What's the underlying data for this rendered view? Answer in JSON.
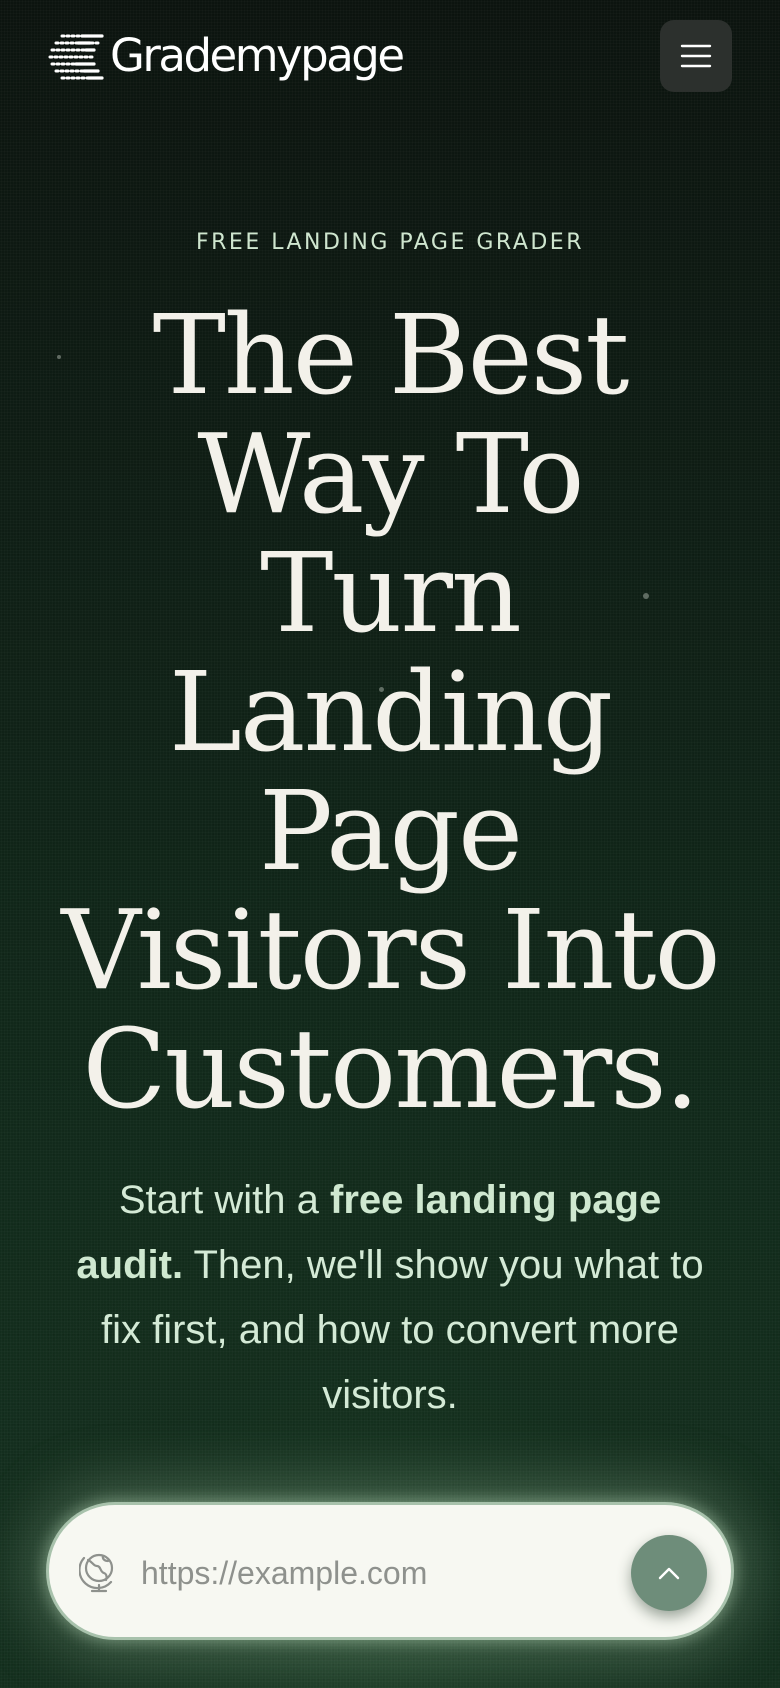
{
  "brand": {
    "name": "Grademypage",
    "logo_icon": "speed-lines-logo-icon"
  },
  "header": {
    "menu_icon": "hamburger-menu-icon"
  },
  "hero": {
    "eyebrow": "FREE LANDING PAGE GRADER",
    "headline_lines": [
      "The Best",
      "Way To",
      "Turn",
      "Landing",
      "Page",
      "Visitors Into",
      "Customers."
    ],
    "subtext": {
      "lead": "Start with a ",
      "highlight": "free landing page audit.",
      "rest": " Then, we'll show you what to fix first, and how to convert more visitors."
    }
  },
  "search": {
    "placeholder": "https://example.com",
    "value": "",
    "icon": "globe-icon",
    "submit_icon": "chevron-up-icon"
  },
  "colors": {
    "background_top": "#0c140f",
    "background_bottom": "#143220",
    "accent_text": "#cfe6cf",
    "menu_button": "#2c302d",
    "submit_button": "#6e8d7a",
    "input_background": "#f7f8f2"
  }
}
